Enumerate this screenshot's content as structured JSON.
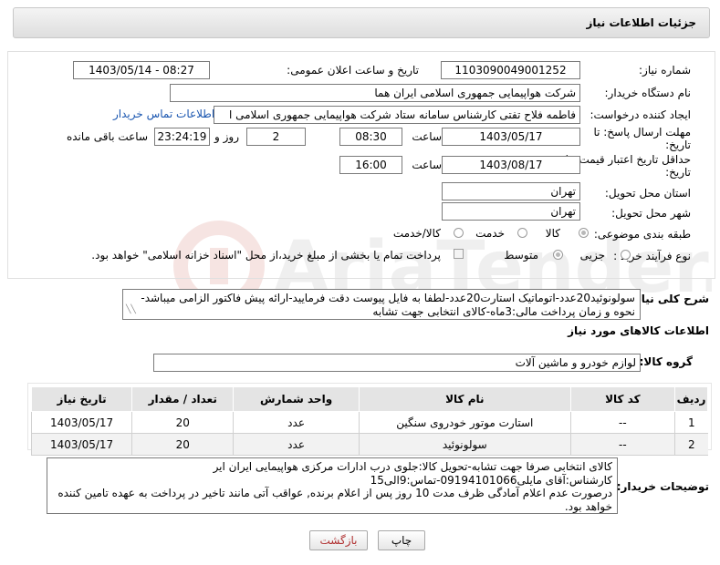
{
  "page": {
    "title": "جزئیات اطلاعات نیاز"
  },
  "form": {
    "need_number_label": "شماره نیاز:",
    "need_number": "1103090049001252",
    "announce_label": "تاریخ و ساعت اعلان عمومی:",
    "announce_value": "1403/05/14 - 08:27",
    "buyer_org_label": "نام دستگاه خریدار:",
    "buyer_org": "شرکت هواپیمایی جمهوری اسلامی ایران هما",
    "requester_label": "ایجاد کننده درخواست:",
    "requester": "فاطمه فلاح تفتی کارشناس سامانه ستاد شرکت هواپیمایی جمهوری اسلامی ا",
    "contact_link": "اطلاعات تماس خریدار",
    "deadline_label_1": "مهلت ارسال پاسخ: تا",
    "deadline_label_2": "تاریخ:",
    "deadline_date": "1403/05/17",
    "time_label": "ساعت",
    "deadline_time": "08:30",
    "days_value": "2",
    "days_label": "روز و",
    "remaining_time": "23:24:19",
    "remaining_label": "ساعت باقی مانده",
    "validity_label_1": "حداقل تاریخ اعتبار قیمت: تا",
    "validity_label_2": "تاریخ:",
    "validity_date": "1403/08/17",
    "validity_time_label": "ساعت",
    "validity_time": "16:00",
    "province_label": "استان محل تحویل:",
    "province": "تهران",
    "city_label": "شهر محل تحویل:",
    "city": "تهران",
    "category_label": "طبقه بندی موضوعی:",
    "category_options": {
      "goods": "کالا",
      "service": "خدمت",
      "goods_service": "کالا/خدمت"
    },
    "process_label": "نوع فرآیند خرید :",
    "process_options": {
      "minor": "جزیی",
      "medium": "متوسط"
    },
    "payment_note": "پرداخت تمام یا بخشی از مبلغ خرید،از محل \"اسناد خزانه اسلامی\" خواهد بود.",
    "summary_label": "شرح کلی نیاز:",
    "summary_line1": "سولونوئید20عدد-اتوماتیک استارت20عدد-لطفا به فایل پیوست دقت فرمایید-ارائه پیش فاکتور الزامی میباشد-",
    "summary_line2": "نحوه و زمان پرداخت مالی:3ماه-کالای انتخابی جهت تشابه"
  },
  "goods_section": {
    "heading": "اطلاعات کالاهای مورد نیاز",
    "group_label": "گروه کالا:",
    "group_value": "لوازم خودرو و ماشین آلات"
  },
  "table": {
    "headers": {
      "row": "ردیف",
      "code": "کد کالا",
      "name": "نام کالا",
      "unit": "واحد شمارش",
      "qty": "تعداد / مقدار",
      "date": "تاریخ نیاز"
    },
    "rows": [
      {
        "row": "1",
        "code": "--",
        "name": "استارت موتور خودروی سنگین",
        "unit": "عدد",
        "qty": "20",
        "date": "1403/05/17"
      },
      {
        "row": "2",
        "code": "--",
        "name": "سولونوئید",
        "unit": "عدد",
        "qty": "20",
        "date": "1403/05/17"
      }
    ]
  },
  "buyer_notes": {
    "label": "توضیحات خریدار:",
    "line1": "کالای انتخابی صرفا جهت تشابه-تحویل کالا:جلوی درب ادارات مرکزی هواپیمایی ایران ایر",
    "line2": "کارشناس:آقای مایلی09194101066-تماس:9الی15",
    "line3": "درصورت عدم اعلام آمادگی ظرف مدت 10 روز پس از اعلام برنده, عواقب آتی مانند تاخیر در پرداخت به عهده تامین کننده",
    "line4": "خواهد بود."
  },
  "buttons": {
    "print": "چاپ",
    "back": "بازگشت"
  },
  "colors": {
    "link": "#1a56b0",
    "header_bg": "#e4e4e4",
    "back_text": "#b03030"
  }
}
